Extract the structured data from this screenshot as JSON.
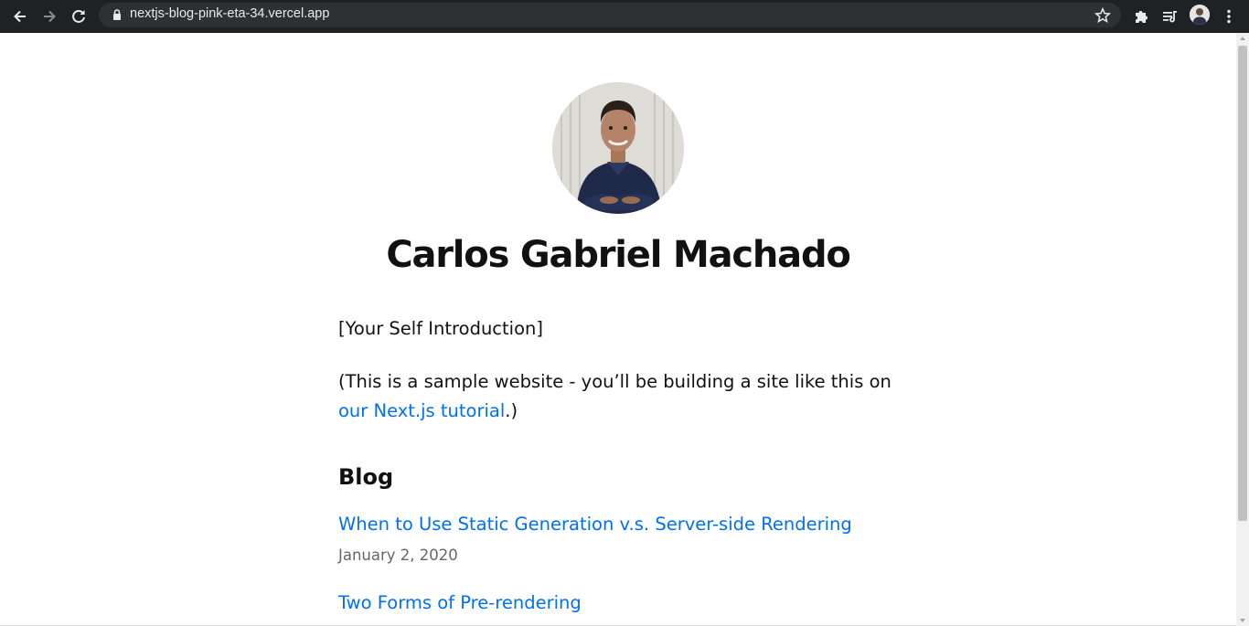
{
  "browser": {
    "url": "nextjs-blog-pink-eta-34.vercel.app",
    "icons": {
      "back": "arrow-left-icon",
      "forward": "arrow-right-icon",
      "reload": "reload-icon",
      "lock": "lock-icon",
      "bookmark": "star-icon",
      "extensions": "puzzle-icon",
      "media": "playlist-icon",
      "profile": "avatar",
      "menu": "kebab-menu-icon"
    }
  },
  "page": {
    "name": "Carlos Gabriel Machado",
    "intro": "[Your Self Introduction]",
    "sample_prefix": "(This is a sample website - you’ll be building a site like this on ",
    "sample_link": "our Next.js tutorial",
    "sample_suffix": ".)",
    "blog_heading": "Blog",
    "posts": [
      {
        "title": "When to Use Static Generation v.s. Server-side Rendering",
        "date": "January 2, 2020"
      },
      {
        "title": "Two Forms of Pre-rendering",
        "date": ""
      }
    ],
    "colors": {
      "link": "#0070f3",
      "text": "#111111",
      "date": "#666666",
      "toolbar": "#202124"
    }
  }
}
